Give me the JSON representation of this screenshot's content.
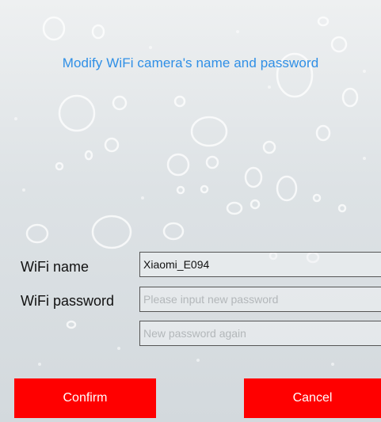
{
  "header": {
    "title": "Modify WiFi camera's name and  password"
  },
  "form": {
    "wifi_name_label": "WiFi  name",
    "wifi_name_value": "Xiaomi_E094",
    "wifi_password_label": "WiFi  password",
    "password_placeholder": "Please input new password",
    "password_again_placeholder": "New password again"
  },
  "buttons": {
    "confirm_label": "Confirm",
    "cancel_label": "Cancel"
  },
  "colors": {
    "title": "#2f8fe6",
    "button": "#ff0000"
  }
}
